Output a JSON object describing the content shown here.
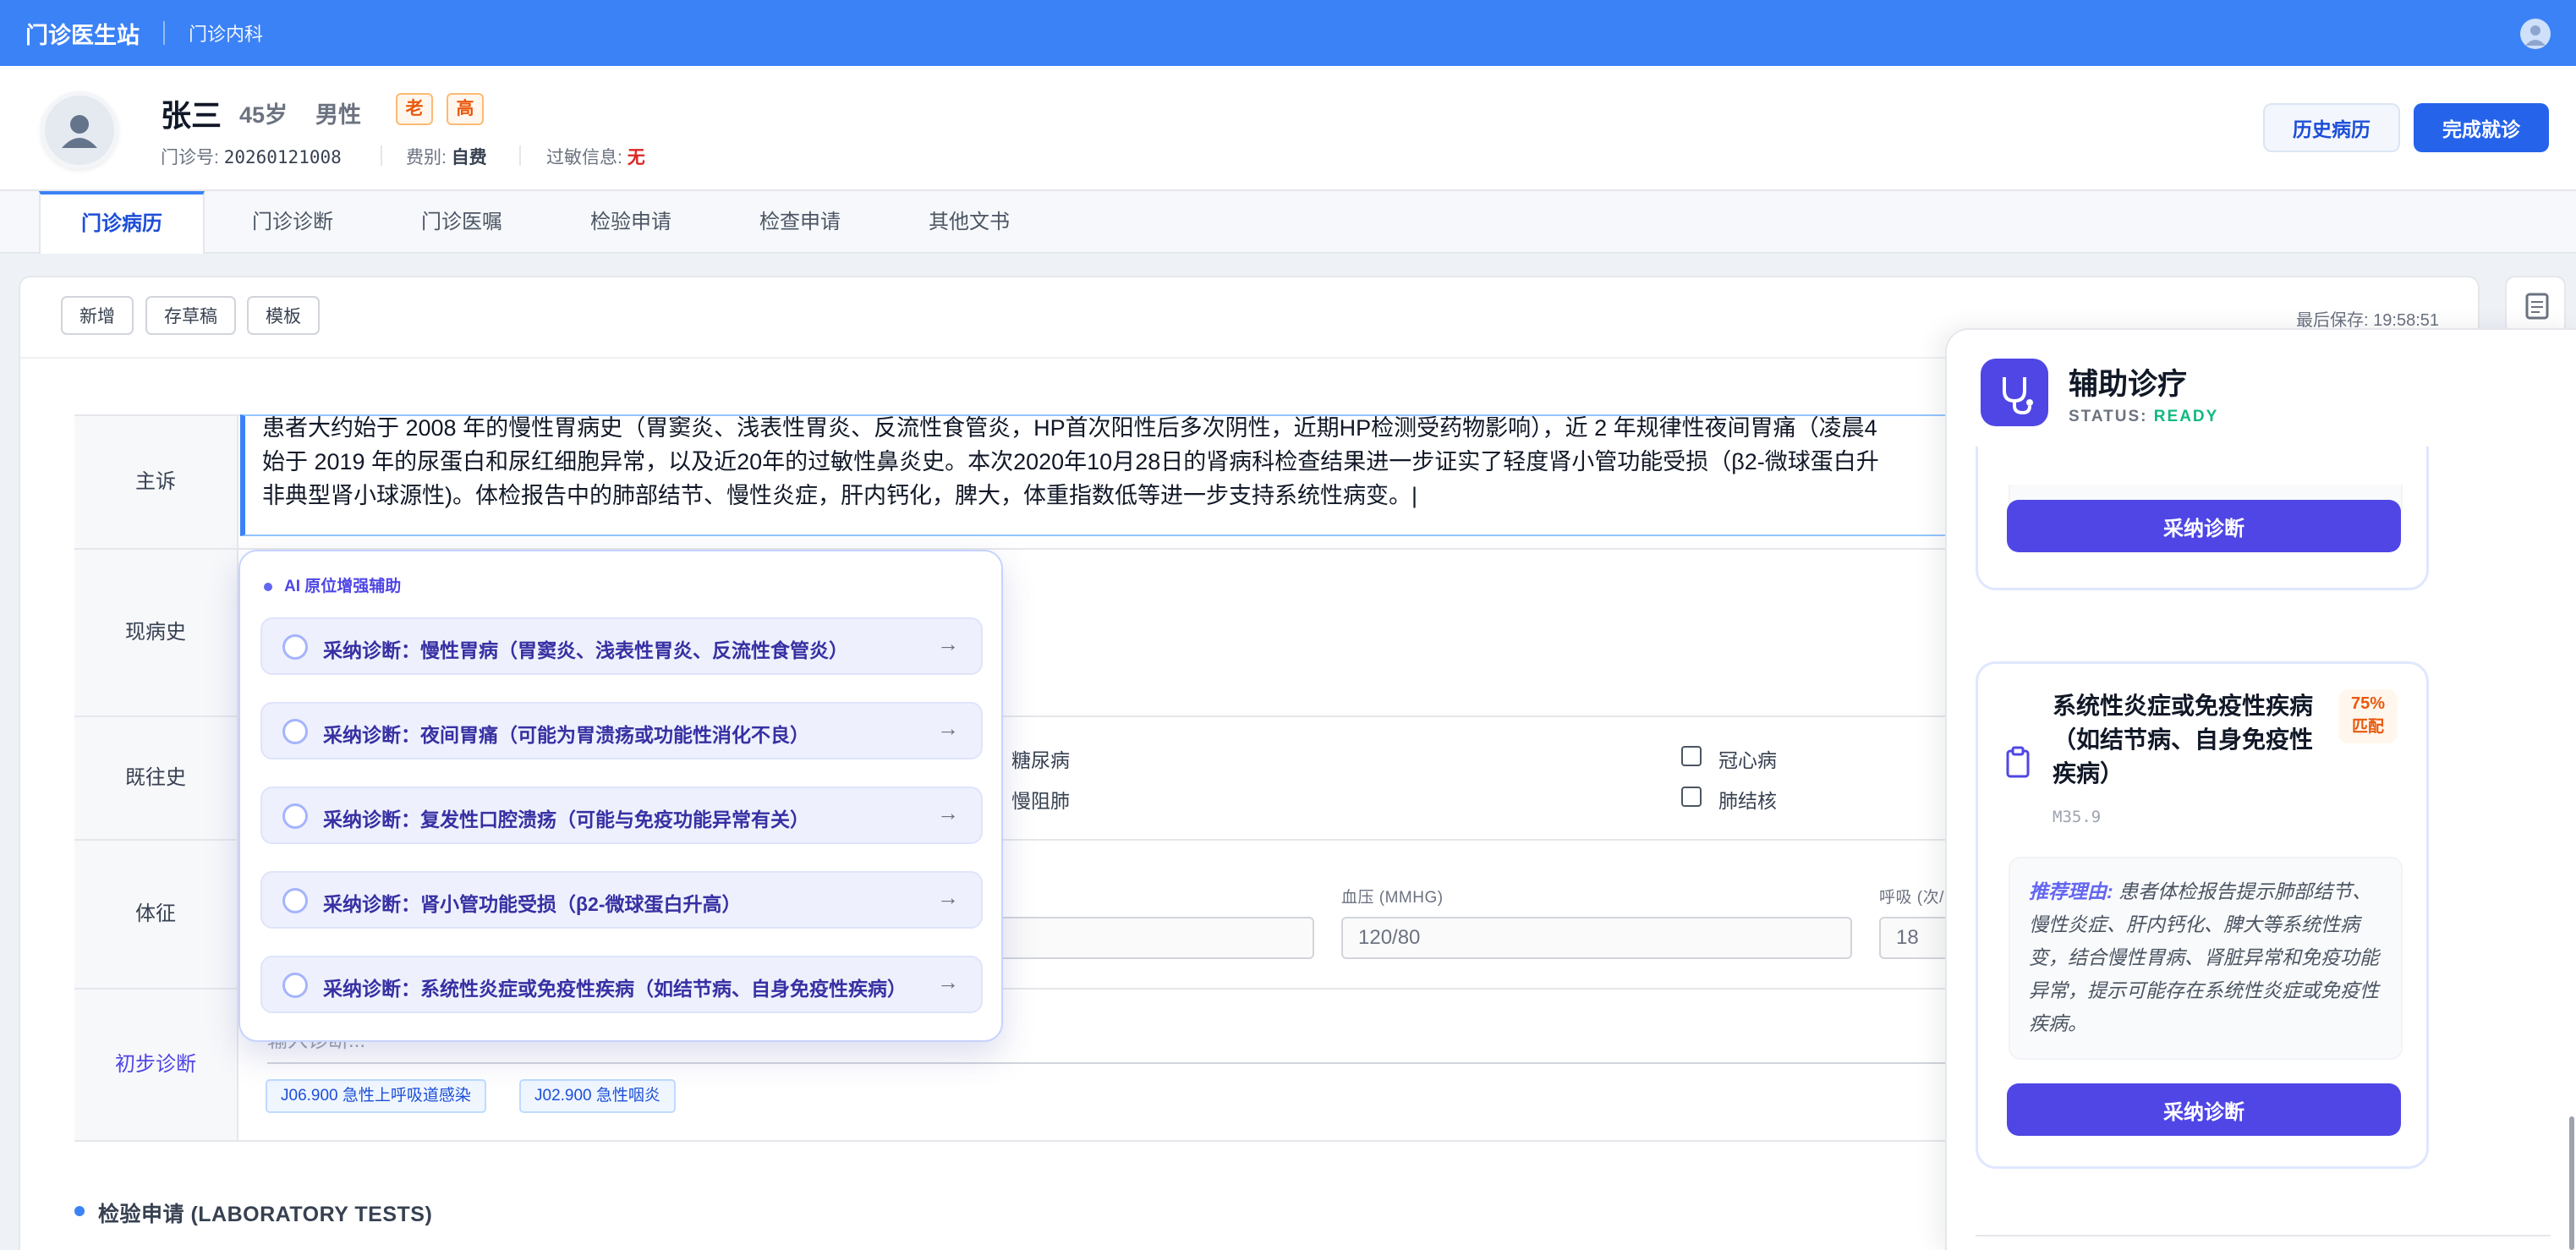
{
  "topbar": {
    "brand": "门诊医生站",
    "dept": "门诊内科"
  },
  "patient": {
    "name": "张三",
    "age": "45岁",
    "sex": "男性",
    "badges": [
      "老",
      "高"
    ],
    "clinic_no_label": "门诊号:",
    "clinic_no": "20260121008",
    "fee_label": "费别:",
    "fee": "自费",
    "allergy_label": "过敏信息:",
    "allergy": "无"
  },
  "actions": {
    "history": "历史病历",
    "finish": "完成就诊"
  },
  "tabs": [
    "门诊病历",
    "门诊诊断",
    "门诊医嘱",
    "检验申请",
    "检查申请",
    "其他文书"
  ],
  "toolbar": {
    "new": "新增",
    "draft": "存草稿",
    "template": "模板",
    "last_save": "最后保存: 19:58:51"
  },
  "form": {
    "labels": {
      "cc": "主诉",
      "hpi": "现病史",
      "pmh": "既往史",
      "vitals": "体征",
      "dx": "初步诊断"
    },
    "cc_lines": [
      "患者大约始于 2008 年的慢性胃病史（胃窦炎、浅表性胃炎、反流性食管炎，HP首次阳性后多次阴性，近期HP检测受药物影响），近 2 年规律性夜间胃痛（凌晨4",
      "始于 2019 年的尿蛋白和尿红细胞异常，以及近20年的过敏性鼻炎史。本次2020年10月28日的肾病科检查结果进一步证实了轻度肾小管功能受损（β2-微球蛋白升",
      "非典型肾小球源性)。体检报告中的肺部结节、慢性炎症，肝内钙化，脾大，体重指数低等进一步支持系统性病变。|"
    ],
    "pmh_items": [
      "糖尿病",
      "慢阻肺",
      "冠心病",
      "肺结核"
    ],
    "vitals": {
      "bp_label": "血压 (MMHG)",
      "bp_value": "120/80",
      "resp_label": "呼吸 (次/",
      "resp_value": "18"
    },
    "dx_placeholder": "输入诊断...",
    "dx_tags": [
      "J06.900 急性上呼吸道感染",
      "J02.900 急性咽炎"
    ]
  },
  "lab_section": "检验申请 (LABORATORY TESTS)",
  "ai_popup": {
    "heading": "AI 原位增强辅助",
    "items": [
      "采纳诊断：慢性胃病（胃窦炎、浅表性胃炎、反流性食管炎）",
      "采纳诊断：夜间胃痛（可能为胃溃疡或功能性消化不良）",
      "采纳诊断：复发性口腔溃疡（可能与免疫功能异常有关）",
      "采纳诊断：肾小管功能受损（β2-微球蛋白升高）",
      "采纳诊断：系统性炎症或免疫性疾病（如结节病、自身免疫性疾病）"
    ]
  },
  "assist": {
    "title": "辅助诊疗",
    "status_label": "STATUS:",
    "status_value": "READY",
    "adopt": "采纳诊断",
    "card2": {
      "title": "系统性炎症或免疫性疾病（如结节病、自身免疫性疾病）",
      "match_pct": "75%",
      "match_label": "匹配",
      "code": "M35.9",
      "reason_label": "推荐理由:",
      "reason": "患者体检报告提示肺部结节、慢性炎症、肝内钙化、脾大等系统性病变，结合慢性胃病、肾脏异常和免疫功能异常，提示可能存在系统性炎症或免疫性疾病。"
    }
  },
  "colors": {
    "primary": "#3b82f6",
    "accent": "#4f46e5",
    "warning": "#ea580c",
    "ready": "#10b981"
  },
  "icons": {
    "avatar": "user-avatar-icon",
    "assist": "stethoscope-icon",
    "clip": "clipboard-icon",
    "side": "notepad-icon"
  }
}
